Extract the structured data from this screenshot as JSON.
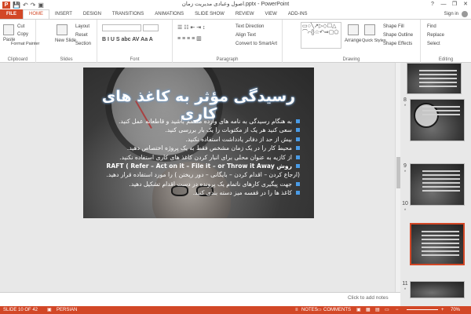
{
  "titlebar": {
    "app_logo": "P",
    "title": "اصول وعبادی مدیریت زمان.pptx - PowerPoint",
    "qat_icons": [
      "save-icon",
      "undo-icon",
      "redo-icon",
      "present-icon"
    ],
    "help": "?",
    "minimize": "—",
    "restore": "❐",
    "close": "✕"
  },
  "tabs": {
    "file": "FILE",
    "items": [
      "HOME",
      "INSERT",
      "DESIGN",
      "TRANSITIONS",
      "ANIMATIONS",
      "SLIDE SHOW",
      "REVIEW",
      "VIEW",
      "ADD-INS"
    ],
    "signin": "Sign in"
  },
  "ribbon": {
    "clipboard": {
      "label": "Clipboard",
      "paste": "Paste",
      "cut": "Cut",
      "copy": "Copy",
      "format_painter": "Format Painter"
    },
    "slides": {
      "label": "Slides",
      "new_slide": "New Slide",
      "layout": "Layout",
      "reset": "Reset",
      "section": "Section"
    },
    "font": {
      "label": "Font"
    },
    "paragraph": {
      "label": "Paragraph",
      "text_direction": "Text Direction",
      "align_text": "Align Text",
      "convert_smartart": "Convert to SmartArt"
    },
    "drawing": {
      "label": "Drawing",
      "arrange": "Arrange",
      "quick_styles": "Quick Styles",
      "shape_fill": "Shape Fill",
      "shape_outline": "Shape Outline",
      "shape_effects": "Shape Effects",
      "shapes_glyphs": "▭○╲↗▷◇☐△⌒⌐{}☆↶⇒▢⬠"
    },
    "editing": {
      "label": "Editing",
      "find": "Find",
      "replace": "Replace",
      "select": "Select"
    }
  },
  "slide": {
    "title": "رسیدگی مؤثر به کاغذ های کاری",
    "bullets": [
      "به هنگام رسیدگی به نامه های وارده مصمم باشید و قاطعانه عمل کنید.",
      "سعی کنید هر یک از مکتوبات را یک بار بررسی کنید.",
      "بیش از حد از دفاتر یادداشت استفاده نکنید.",
      "محیط کار را در یک زمان مشخص فقط به یک پروژه اختصاص دهید.",
      "از کازیه به عنوان محلی برای انبار کردن کاغذ های کاری استفاده نکنید.",
      "روش  RAFT ( Refer – Act on it – File it – or Throw it Away",
      "(ارجاع کردن – اقدام کردن – بایگانی – دور ریختن ) را مورد استفاده قرار دهید.",
      "جهت پیگیری کارهای ناتمام یک پرونده در دست اقدام تشکیل دهید.",
      "کاغذ ها را در قفسه میز دسته بندی کنید."
    ]
  },
  "thumbnails": [
    {
      "number": "",
      "star": ""
    },
    {
      "number": "8",
      "star": "*"
    },
    {
      "number": "9",
      "star": "*"
    },
    {
      "number": "10",
      "star": "*"
    },
    {
      "number": "11",
      "star": "*"
    }
  ],
  "notes": {
    "placeholder": "Click to add notes"
  },
  "status": {
    "slide_info": "SLIDE 10 OF 42",
    "language": "PERSIAN",
    "notes": "NOTES",
    "comments": "COMMENTS",
    "zoom": "70%"
  },
  "colors": {
    "accent": "#d24726",
    "bullet": "#4a9be6"
  }
}
